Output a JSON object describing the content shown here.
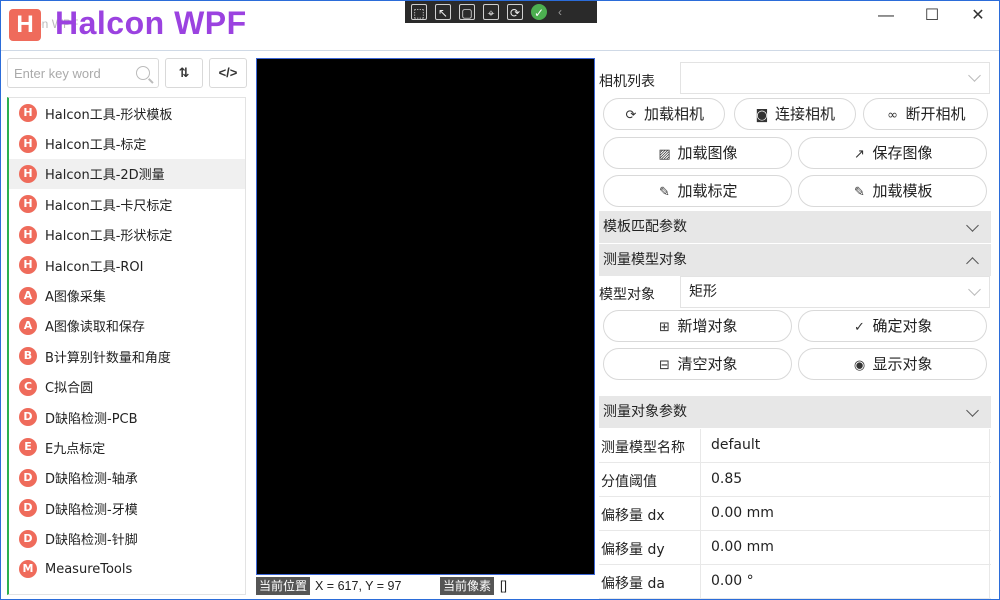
{
  "titlebar": {
    "logo_letter": "H",
    "faint_title": "Halcon WPF",
    "title": "Halcon WPF",
    "window_buttons": {
      "minimize": "—",
      "maximize": "☐",
      "close": "✕"
    },
    "devbar_icons": [
      "select-element-icon",
      "pointer-icon",
      "layout-adorner-icon",
      "track-focus-icon",
      "hot-reload-icon",
      "binding-check-icon"
    ]
  },
  "sidebar": {
    "search_placeholder": "Enter key word",
    "sort_button": "⇅",
    "code_button": "</>",
    "accent_color": "#2db04f",
    "items": [
      {
        "badge": "H",
        "label": "Halcon工具-形状模板"
      },
      {
        "badge": "H",
        "label": "Halcon工具-标定"
      },
      {
        "badge": "H",
        "label": "Halcon工具-2D测量",
        "active": true
      },
      {
        "badge": "H",
        "label": "Halcon工具-卡尺标定"
      },
      {
        "badge": "H",
        "label": "Halcon工具-形状标定"
      },
      {
        "badge": "H",
        "label": "Halcon工具-ROI"
      },
      {
        "badge": "A",
        "label": "A图像采集"
      },
      {
        "badge": "A",
        "label": "A图像读取和保存"
      },
      {
        "badge": "B",
        "label": "B计算别针数量和角度"
      },
      {
        "badge": "C",
        "label": "C拟合圆"
      },
      {
        "badge": "D",
        "label": "D缺陷检测-PCB"
      },
      {
        "badge": "E",
        "label": "E九点标定"
      },
      {
        "badge": "D",
        "label": "D缺陷检测-轴承"
      },
      {
        "badge": "D",
        "label": "D缺陷检测-牙模"
      },
      {
        "badge": "D",
        "label": "D缺陷检测-针脚"
      },
      {
        "badge": "M",
        "label": "MeasureTools"
      }
    ]
  },
  "viewer": {
    "pos_tag": "当前位置",
    "pos_value": "X = 617, Y = 97",
    "pixel_tag": "当前像素",
    "pixel_value": "[]"
  },
  "right": {
    "camera_list_label": "相机列表",
    "camera_list_value": "",
    "buttons_row1": [
      "加载相机",
      "连接相机",
      "断开相机"
    ],
    "buttons_row2": [
      "加载图像",
      "保存图像"
    ],
    "buttons_row3": [
      "加载标定",
      "加载模板"
    ],
    "section_template": "模板匹配参数",
    "section_measure_model": "测量模型对象",
    "model_object_label": "模型对象",
    "model_object_value": "矩形",
    "buttons_row4": [
      "新增对象",
      "确定对象"
    ],
    "buttons_row5": [
      "清空对象",
      "显示对象"
    ],
    "section_measure_params": "测量对象参数",
    "params": [
      {
        "label": "测量模型名称",
        "value": "default"
      },
      {
        "label": "分值阈值",
        "value": "0.85"
      },
      {
        "label": "偏移量 dx",
        "value": "0.00 mm"
      },
      {
        "label": "偏移量 dy",
        "value": "0.00 mm"
      },
      {
        "label": "偏移量 da",
        "value": "0.00 °"
      }
    ]
  }
}
